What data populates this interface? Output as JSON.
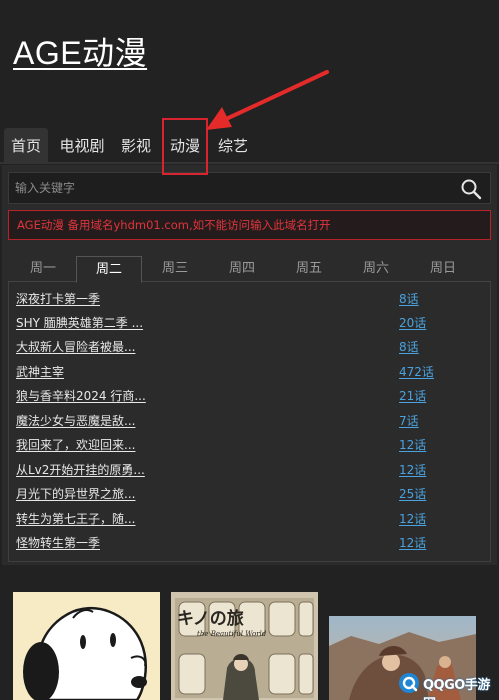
{
  "site": {
    "title": "AGE动漫"
  },
  "nav": {
    "items": [
      {
        "label": "首页"
      },
      {
        "label": "电视剧"
      },
      {
        "label": "影视"
      },
      {
        "label": "动漫"
      },
      {
        "label": "综艺"
      }
    ],
    "active_index": 0
  },
  "search": {
    "placeholder": "输入关键字"
  },
  "notice": {
    "text": "AGE动漫 备用域名yhdm01.com,如不能访问输入此域名打开"
  },
  "weekdays": {
    "tabs": [
      "周一",
      "周二",
      "周三",
      "周四",
      "周五",
      "周六",
      "周日"
    ],
    "active_index": 1
  },
  "anime_list": [
    {
      "title": "深夜打卡第一季",
      "episodes": "8话"
    },
    {
      "title": "SHY 腼腆英雄第二季 ...",
      "episodes": "20话"
    },
    {
      "title": "大叔新人冒险者被最...",
      "episodes": "8话"
    },
    {
      "title": "武神主宰",
      "episodes": "472话"
    },
    {
      "title": "狼与香辛料2024 行商...",
      "episodes": "21话"
    },
    {
      "title": "魔法少女与恶魔是敌...",
      "episodes": "7话"
    },
    {
      "title": "我回来了，欢迎回来...",
      "episodes": "12话"
    },
    {
      "title": "从Lv2开始开挂的原勇...",
      "episodes": "12话"
    },
    {
      "title": "月光下的异世界之旅...",
      "episodes": "25话"
    },
    {
      "title": "转生为第七王子，随...",
      "episodes": "12话"
    },
    {
      "title": "怪物转生第一季",
      "episodes": "12话"
    }
  ],
  "thumbnails": {
    "second_title": "キノの旅",
    "second_subtitle": "the Beautiful World"
  },
  "watermark": {
    "text": "QQGO手游网"
  },
  "colors": {
    "background": "#222222",
    "panel": "#2b2b2b",
    "accent_red": "#d9232e",
    "link_blue": "#4aa3df"
  }
}
